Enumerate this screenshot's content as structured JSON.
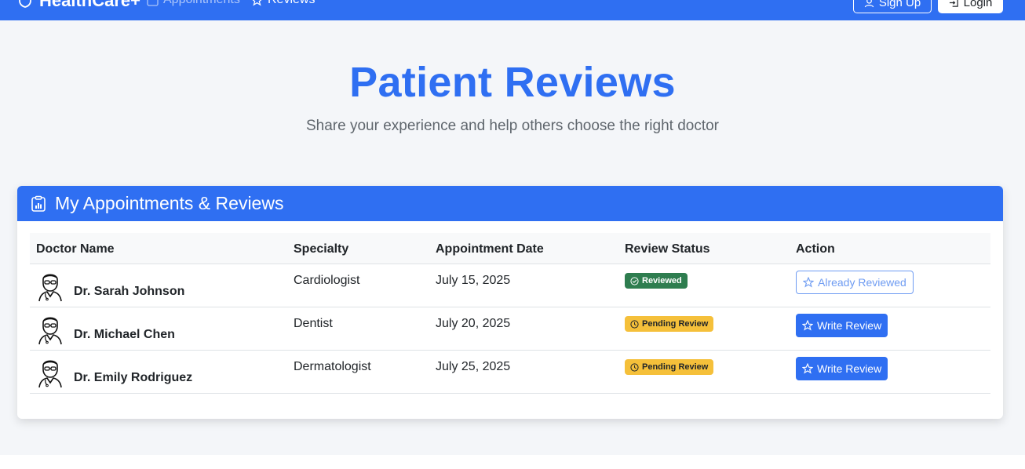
{
  "nav": {
    "brand": "HealthCare+",
    "links": [
      {
        "label": "Appointments",
        "icon": "calendar-icon"
      },
      {
        "label": "Reviews",
        "icon": "star-icon"
      }
    ],
    "signup_label": "Sign Up",
    "login_label": "Login"
  },
  "hero": {
    "title": "Patient Reviews",
    "subtitle": "Share your experience and help others choose the right doctor"
  },
  "card": {
    "title": "My Appointments & Reviews",
    "columns": [
      "Doctor Name",
      "Specialty",
      "Appointment Date",
      "Review Status",
      "Action"
    ],
    "rows": [
      {
        "doctor": "Dr. Sarah Johnson",
        "specialty": "Cardiologist",
        "date": "July 15, 2025",
        "status": "Reviewed",
        "action": "Already Reviewed"
      },
      {
        "doctor": "Dr. Michael Chen",
        "specialty": "Dentist",
        "date": "July 20, 2025",
        "status": "Pending Review",
        "action": "Write Review"
      },
      {
        "doctor": "Dr. Emily Rodriguez",
        "specialty": "Dermatologist",
        "date": "July 25, 2025",
        "status": "Pending Review",
        "action": "Write Review"
      }
    ]
  },
  "colors": {
    "primary": "#2f6ff2",
    "success": "#2e7d4f",
    "warning": "#f5c03a",
    "background": "#f4f6f9"
  }
}
